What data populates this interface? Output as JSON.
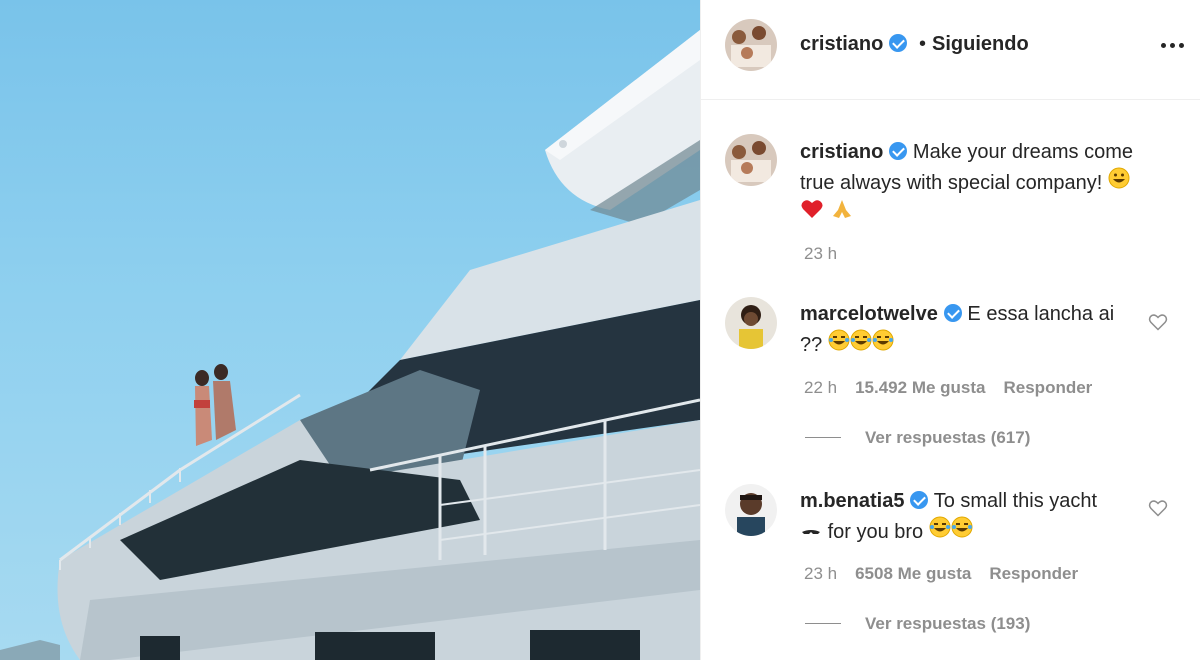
{
  "post": {
    "author": "cristiano",
    "follow_status": "Siguiendo",
    "separator": "•",
    "caption_text": "Make your dreams come true always with special company!",
    "caption_emojis": [
      "grinning-face-emoji",
      "red-heart-emoji",
      "folded-hands-emoji"
    ],
    "caption_time": "23 h"
  },
  "comments": [
    {
      "user": "marcelotwelve",
      "text": "E essa lancha ai ??",
      "emojis": [
        "tears-of-joy-emoji",
        "tears-of-joy-emoji",
        "tears-of-joy-emoji"
      ],
      "time": "22 h",
      "likes": "15.492 Me gusta",
      "reply": "Responder",
      "view_replies": "Ver respuestas (617)"
    },
    {
      "user": "m.benatia5",
      "text_a": "To small this yacht",
      "text_b": "for you bro",
      "emojis": [
        "sunglasses-emoji",
        "tears-of-joy-emoji",
        "tears-of-joy-emoji"
      ],
      "time": "23 h",
      "likes": "6508 Me gusta",
      "reply": "Responder",
      "view_replies": "Ver respuestas (193)"
    }
  ],
  "colors": {
    "text": "#262626",
    "muted": "#8e8e8e",
    "verified": "#3897f0",
    "sky": "#8fd0ef"
  }
}
